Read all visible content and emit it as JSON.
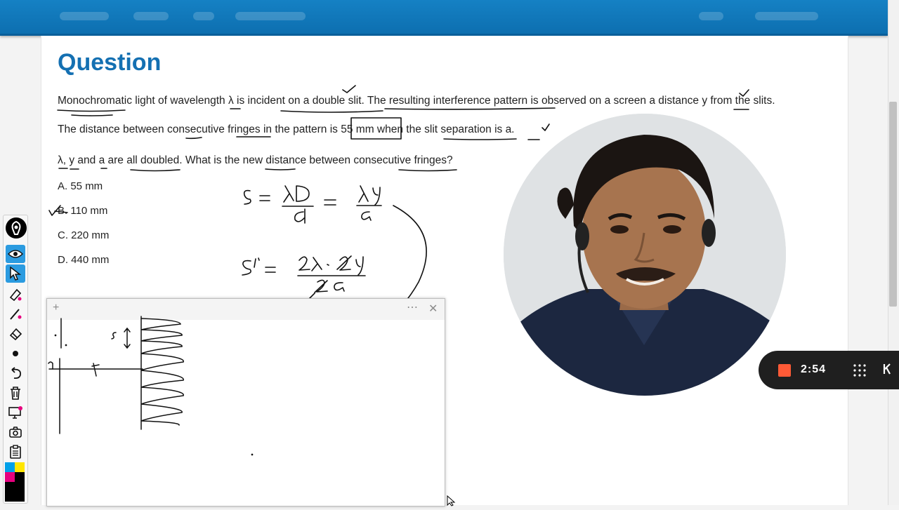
{
  "question": {
    "title": "Question",
    "line1": "Monochromatic light of wavelength λ is incident on a double slit. The resulting interference pattern is observed on a screen a distance y from the slits.",
    "line2": "The distance between consecutive fringes in the pattern is 55 mm when the slit separation is a.",
    "line3": "λ, y and a are all doubled. What is the new distance between consecutive fringes?"
  },
  "options": [
    {
      "label": "A. 55 mm"
    },
    {
      "label": "B. 110 mm"
    },
    {
      "label": "C. 220 mm"
    },
    {
      "label": "D. 440 mm"
    }
  ],
  "whiteboard": {
    "add_icon": "plus-icon",
    "more_icon": "ellipsis-icon",
    "close_icon": "close-icon"
  },
  "recording": {
    "time": "2:54",
    "record_color": "#ff5a36"
  },
  "toolbar": {
    "tools": [
      "eye-icon",
      "pointer-icon",
      "highlighter-icon",
      "pen-icon",
      "eraser-icon",
      "dot-icon",
      "undo-icon",
      "trash-icon",
      "screen-icon",
      "camera-icon",
      "clipboard-icon"
    ],
    "colors": [
      "#00a0e9",
      "#ffe600",
      "#e6007e",
      "#000000"
    ]
  }
}
